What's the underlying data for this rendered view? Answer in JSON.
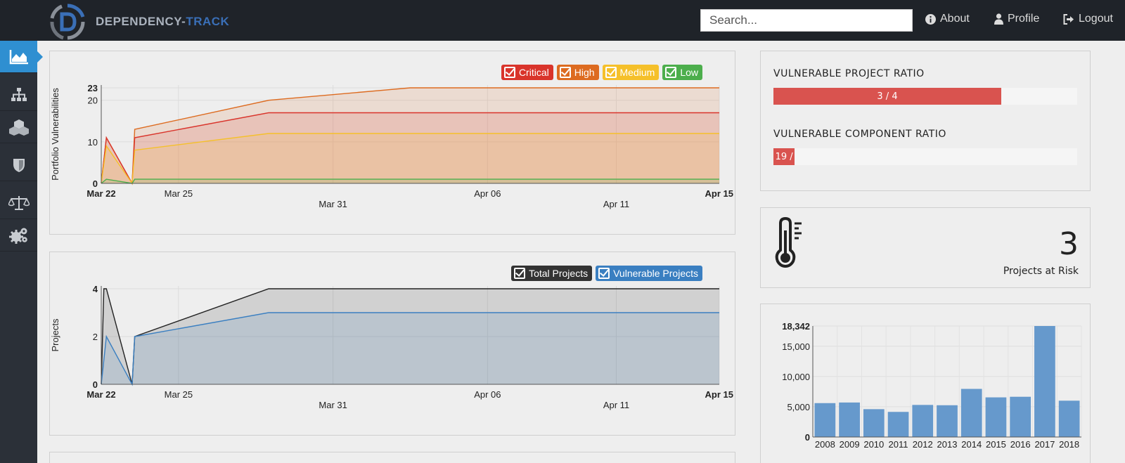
{
  "header": {
    "brand_part1": "DEPENDENCY-",
    "brand_part2": "TRACK",
    "search_placeholder": "Search...",
    "about_label": "About",
    "profile_label": "Profile",
    "logout_label": "Logout"
  },
  "sidebar": {
    "items": [
      {
        "icon": "area-chart-icon",
        "active": true
      },
      {
        "icon": "sitemap-icon",
        "active": false
      },
      {
        "icon": "cubes-icon",
        "active": false
      },
      {
        "icon": "shield-icon",
        "active": false
      },
      {
        "icon": "balance-scale-icon",
        "active": false
      },
      {
        "icon": "cogs-icon",
        "active": false
      }
    ]
  },
  "portfolio_chart": {
    "legend": [
      {
        "label": "Critical",
        "color": "#d9342b"
      },
      {
        "label": "High",
        "color": "#dd6b20"
      },
      {
        "label": "Medium",
        "color": "#f5c02a"
      },
      {
        "label": "Low",
        "color": "#4cae4c"
      }
    ]
  },
  "projects_chart": {
    "legend": [
      {
        "label": "Total Projects",
        "color": "#333333"
      },
      {
        "label": "Vulnerable Projects",
        "color": "#3a7fc1"
      }
    ]
  },
  "ratios": {
    "project_title": "VULNERABLE PROJECT RATIO",
    "project_value": "3 / 4",
    "project_fraction": 0.75,
    "component_title": "VULNERABLE COMPONENT RATIO",
    "component_value": "19 /",
    "component_fraction": 0.07
  },
  "risk": {
    "value": "3",
    "label": "Projects at Risk"
  },
  "chart_data": [
    {
      "type": "area",
      "ylabel": "Portfolio Vulnerabilities",
      "ylim": [
        0,
        23
      ],
      "y_ticks": [
        "0",
        "10",
        "20",
        "23"
      ],
      "x_ticks": [
        "Mar 22",
        "Mar 25",
        "Mar 31",
        "Apr 06",
        "Apr 11",
        "Apr 15"
      ],
      "x_range": [
        "2018-03-22",
        "2018-04-15"
      ],
      "series": [
        {
          "name": "High",
          "color": "#dd6b20",
          "points": [
            [
              "2018-03-22",
              0
            ],
            [
              "2018-03-22.2",
              11
            ],
            [
              "2018-03-23.2",
              0
            ],
            [
              "2018-03-23.3",
              13
            ],
            [
              "2018-03-28.5",
              20
            ],
            [
              "2018-04-03",
              23
            ],
            [
              "2018-04-15",
              23
            ]
          ]
        },
        {
          "name": "Critical",
          "color": "#d9342b",
          "points": [
            [
              "2018-03-22",
              0
            ],
            [
              "2018-03-22.2",
              11
            ],
            [
              "2018-03-23.2",
              0
            ],
            [
              "2018-03-23.3",
              11
            ],
            [
              "2018-03-28.5",
              17
            ],
            [
              "2018-04-15",
              17
            ]
          ]
        },
        {
          "name": "Medium",
          "color": "#f5c02a",
          "points": [
            [
              "2018-03-22",
              0
            ],
            [
              "2018-03-22.2",
              9
            ],
            [
              "2018-03-23.2",
              0
            ],
            [
              "2018-03-23.3",
              8
            ],
            [
              "2018-03-28.5",
              12
            ],
            [
              "2018-04-15",
              12
            ]
          ]
        },
        {
          "name": "Low",
          "color": "#4cae4c",
          "points": [
            [
              "2018-03-22",
              0
            ],
            [
              "2018-03-22.2",
              1
            ],
            [
              "2018-03-23.2",
              0
            ],
            [
              "2018-03-23.3",
              1
            ],
            [
              "2018-04-15",
              1
            ]
          ]
        }
      ]
    },
    {
      "type": "area",
      "ylabel": "Projects",
      "ylim": [
        0,
        4
      ],
      "y_ticks": [
        "0",
        "2",
        "4"
      ],
      "x_ticks": [
        "Mar 22",
        "Mar 25",
        "Mar 31",
        "Apr 06",
        "Apr 11",
        "Apr 15"
      ],
      "x_range": [
        "2018-03-22",
        "2018-04-15"
      ],
      "series": [
        {
          "name": "Total Projects",
          "color": "#222222",
          "points": [
            [
              "2018-03-22",
              0
            ],
            [
              "2018-03-22.1",
              4
            ],
            [
              "2018-03-22.2",
              4
            ],
            [
              "2018-03-23.2",
              0
            ],
            [
              "2018-03-23.3",
              2
            ],
            [
              "2018-03-28.5",
              4
            ],
            [
              "2018-04-15",
              4
            ]
          ]
        },
        {
          "name": "Vulnerable Projects",
          "color": "#3a7fc1",
          "points": [
            [
              "2018-03-22",
              0
            ],
            [
              "2018-03-22.2",
              2
            ],
            [
              "2018-03-23.2",
              0
            ],
            [
              "2018-03-23.3",
              2
            ],
            [
              "2018-03-28.5",
              3
            ],
            [
              "2018-04-15",
              3
            ]
          ]
        }
      ]
    },
    {
      "type": "bar",
      "categories": [
        "2008",
        "2009",
        "2010",
        "2011",
        "2012",
        "2013",
        "2014",
        "2015",
        "2016",
        "2017",
        "2018"
      ],
      "values": [
        5600,
        5700,
        4600,
        4150,
        5300,
        5250,
        7950,
        6550,
        6650,
        18342,
        6000
      ],
      "ylim": [
        0,
        18342
      ],
      "y_ticks": [
        "0",
        "5,000",
        "10,000",
        "15,000",
        "18,342"
      ],
      "color": "#6699cc"
    }
  ]
}
